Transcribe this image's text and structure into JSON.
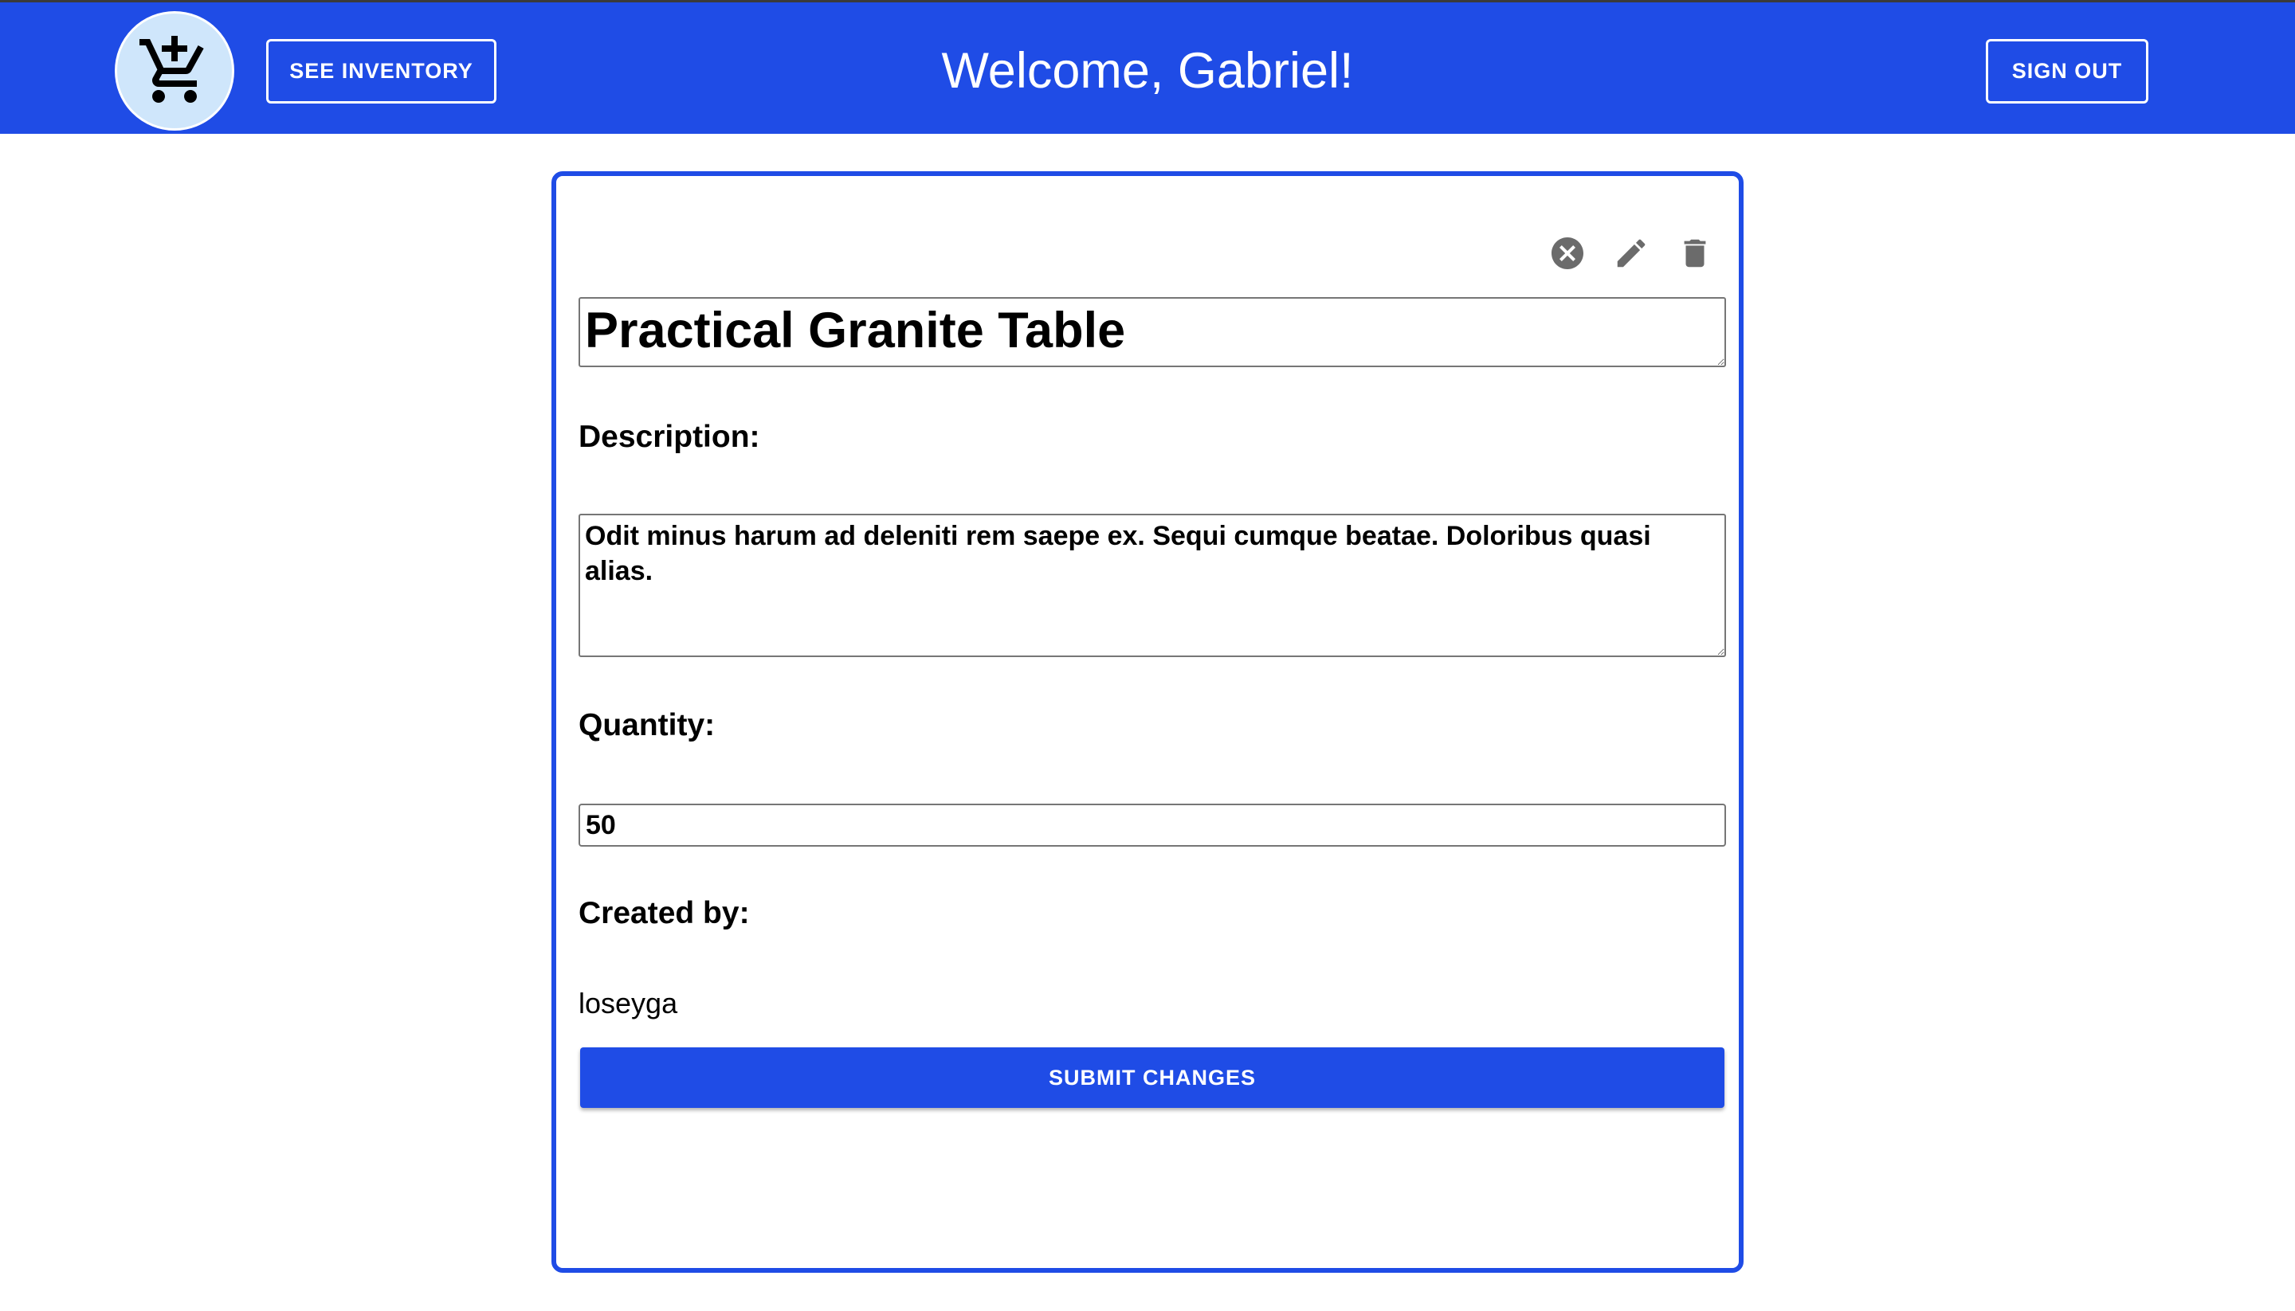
{
  "header": {
    "logo_icon": "cart-alert-icon",
    "see_inventory_label": "SEE INVENTORY",
    "welcome_text": "Welcome, Gabriel!",
    "sign_out_label": "SIGN OUT"
  },
  "item": {
    "actions": {
      "close_icon": "close-circle-icon",
      "edit_icon": "pencil-icon",
      "delete_icon": "trash-icon"
    },
    "title": "Practical Granite Table",
    "description_label": "Description:",
    "description": "Odit minus harum ad deleniti rem saepe ex. Sequi cumque beatae. Doloribus quasi alias.",
    "quantity_label": "Quantity:",
    "quantity": "50",
    "created_by_label": "Created by:",
    "created_by": "loseyga",
    "submit_label": "SUBMIT CHANGES"
  },
  "colors": {
    "primary": "#1f4ce6",
    "logo_bg": "#cfe6fb",
    "icon_gray": "#6b6b6b"
  }
}
